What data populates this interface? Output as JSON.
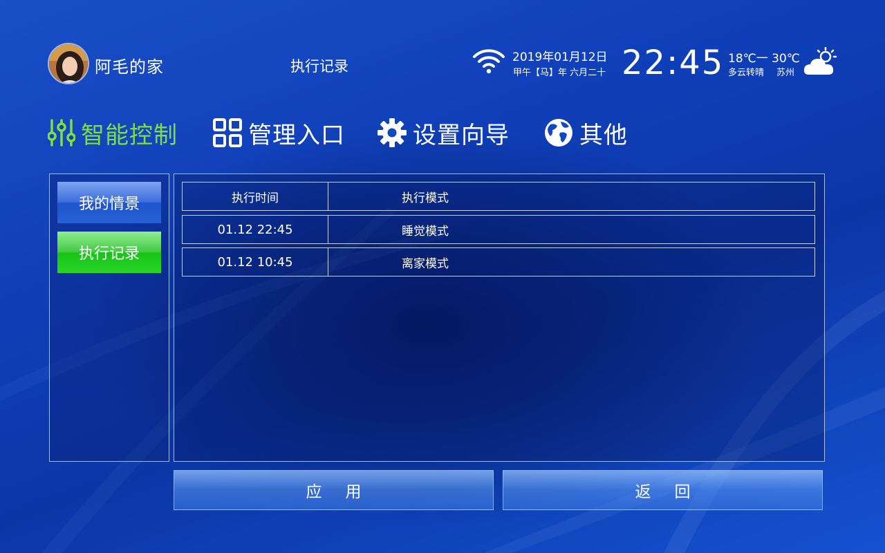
{
  "header": {
    "home_name": "阿毛的家",
    "page_title": "执行记录",
    "date": "2019年01月12日",
    "lunar": "甲午【马】年 六月二十",
    "time": "22:45",
    "temperature": "18℃一 30℃",
    "weather": "多云转晴",
    "city": "苏州",
    "wifi_icon": "wifi-icon",
    "weather_icon": "partly-cloudy-icon"
  },
  "nav": {
    "items": [
      {
        "label": "智能控制",
        "icon": "sliders-icon",
        "active": true
      },
      {
        "label": "管理入口",
        "icon": "grid-icon",
        "active": false
      },
      {
        "label": "设置向导",
        "icon": "gear-icon",
        "active": false
      },
      {
        "label": "其他",
        "icon": "globe-icon",
        "active": false
      }
    ]
  },
  "sidebar": {
    "items": [
      {
        "label": "我的情景"
      },
      {
        "label": "执行记录",
        "selected": true
      }
    ]
  },
  "records": {
    "columns": [
      "执行时间",
      "执行模式"
    ],
    "rows": [
      [
        "01.12 22:45",
        "睡觉模式"
      ],
      [
        "01.12 10:45",
        "离家模式"
      ]
    ]
  },
  "actions": {
    "apply": "应用",
    "back": "返回"
  },
  "colors": {
    "active_nav": "#7ee040",
    "selected_sidebar": "#16c416",
    "scene_button": "#2a62d6",
    "background": "#0f3fb8"
  }
}
